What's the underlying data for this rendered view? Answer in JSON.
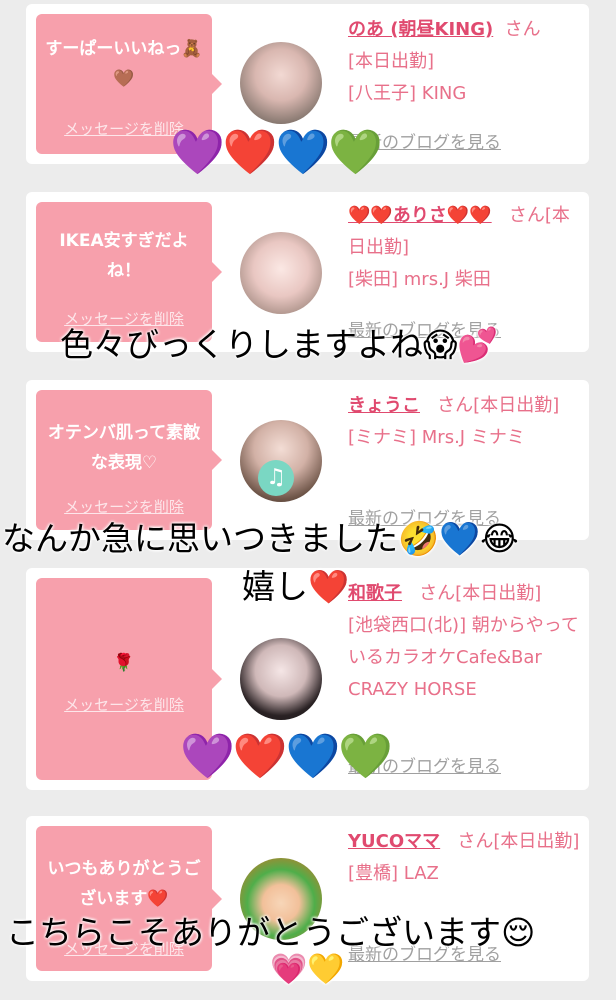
{
  "cards": [
    {
      "message": "すーぱーいいねっ🧸🤎",
      "delete_label": "メッセージを削除",
      "name": "のあ (朝昼KING)",
      "san": "さん",
      "status": "[本日出勤]",
      "area": "[八王子] KING",
      "blog": "最新のブログを見る"
    },
    {
      "message": "IKEA安すぎだよね！",
      "delete_label": "メッセージを削除",
      "name": "❤️❤️ありさ❤️❤️",
      "san": "さん[本日出勤]",
      "status": "",
      "area": "[柴田] mrs.J 柴田",
      "blog": "最新のブログを見る"
    },
    {
      "message": "オテンバ肌って素敵な表現♡",
      "delete_label": "メッセージを削除",
      "name": "きょうこ",
      "san": "さん[本日出勤]",
      "status": "",
      "area": "[ミナミ] Mrs.J ミナミ",
      "blog": "最新のブログを見る"
    },
    {
      "message": "🌹",
      "delete_label": "メッセージを削除",
      "name": "和歌子",
      "san": "さん[本日出勤]",
      "status": "",
      "area": "[池袋西口(北)] 朝からやっているカラオケCafe&Bar CRAZY HORSE",
      "blog": "最新のブログを見る"
    },
    {
      "message": "いつもありがとうございます❤️",
      "delete_label": "メッセージを削除",
      "name": "YUCOママ",
      "san": "さん[本日出勤]",
      "status": "",
      "area": "[豊橋] LAZ",
      "blog": "最新のブログを見る"
    }
  ],
  "overlays": {
    "hearts_row": "💜❤️💙💚",
    "text1": "色々びっくりしますよね😱💕",
    "text2": "なんか急に思いつきました🤣💙😂",
    "text3": "嬉し❤️",
    "text4": "こちらこそありがとうございます😌",
    "text5": "💗💛"
  }
}
